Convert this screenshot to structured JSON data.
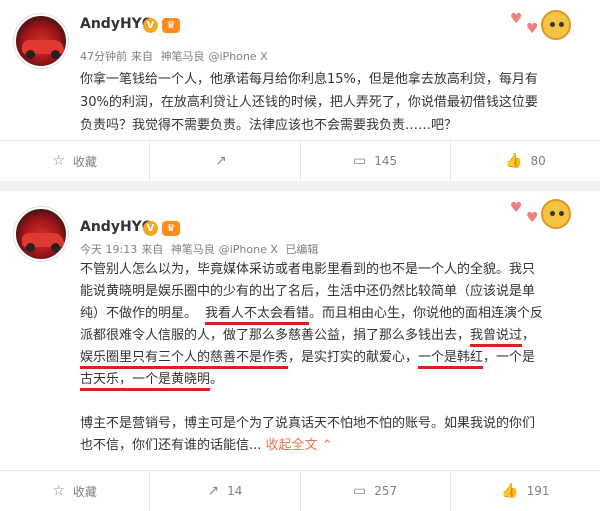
{
  "post1": {
    "username": "AndyHYQ",
    "v_badge": "V",
    "vip_badge": "♛",
    "meta": {
      "time": "47分钟前",
      "source_prefix": "来自",
      "source": "神笔马良",
      "device": "@iPhone X"
    },
    "content_lines": [
      "你拿一笔钱给一个人，他承诺每月给你利息15%，但是他拿去放高利贷，每月有",
      "30%的利润，在放高利贷让人还钱的时候，把人弄死了，你说借最初借钱这位要",
      "负责吗？我觉得不需要负责。法律应该也不会需要我负责……吧？"
    ],
    "actions": {
      "favorite_label": "收藏",
      "repost_count": "",
      "comment_count": "145",
      "like_count": "80"
    }
  },
  "post2": {
    "username": "AndyHYQ",
    "v_badge": "V",
    "vip_badge": "♛",
    "meta": {
      "time": "今天 19:13",
      "source_prefix": "来自",
      "source": "神笔马良",
      "device": "@iPhone X",
      "edited": "已编辑"
    },
    "content": {
      "l1": "不管别人怎么以为，毕竟媒体采访或者电影里看到的也不是一个人的全貌。我只",
      "l2": "能说黄晓明是娱乐圈中的少有的出了名后，生活中还仍然比较简单（应该说是单",
      "l3": "纯）不做作的明星。",
      "l4_u": "我看人不太会看错",
      "l4_rest": "。而且相由心生，你说他的面相连演个反",
      "l5_a": "派都很难令人信服的人，做了那么多慈善公益，捐了那么多钱出去，",
      "l5_u": "我曾说过",
      "l5_b": "，",
      "l6_u": "娱乐圈里只有三个人的慈善不是作秀",
      "l6_mid": "，是实打实的献爱心，",
      "l6_u2": "一个是韩红",
      "l6_end": "，一个是",
      "l7_u": "古天乐，一个是黄晓明",
      "l7_end": "。",
      "l8": "博主不是营销号，博主可是个为了说真话天不怕地不怕的账号。如果我说的你们",
      "l9": "也不信，你们还有谁的话能信...",
      "collapse": "收起全文",
      "collapse_icon": "⌃"
    },
    "actions": {
      "favorite_label": "收藏",
      "repost_count": "14",
      "comment_count": "257",
      "like_count": "191"
    }
  },
  "icons": {
    "favorite": "star-icon",
    "repost": "repost-icon",
    "comment": "comment-icon",
    "like": "thumbs-up-icon"
  },
  "colors": {
    "underline": "#e02020",
    "link": "#eb7350",
    "vip": "#ff8c1a",
    "verified": "#f7a723"
  }
}
